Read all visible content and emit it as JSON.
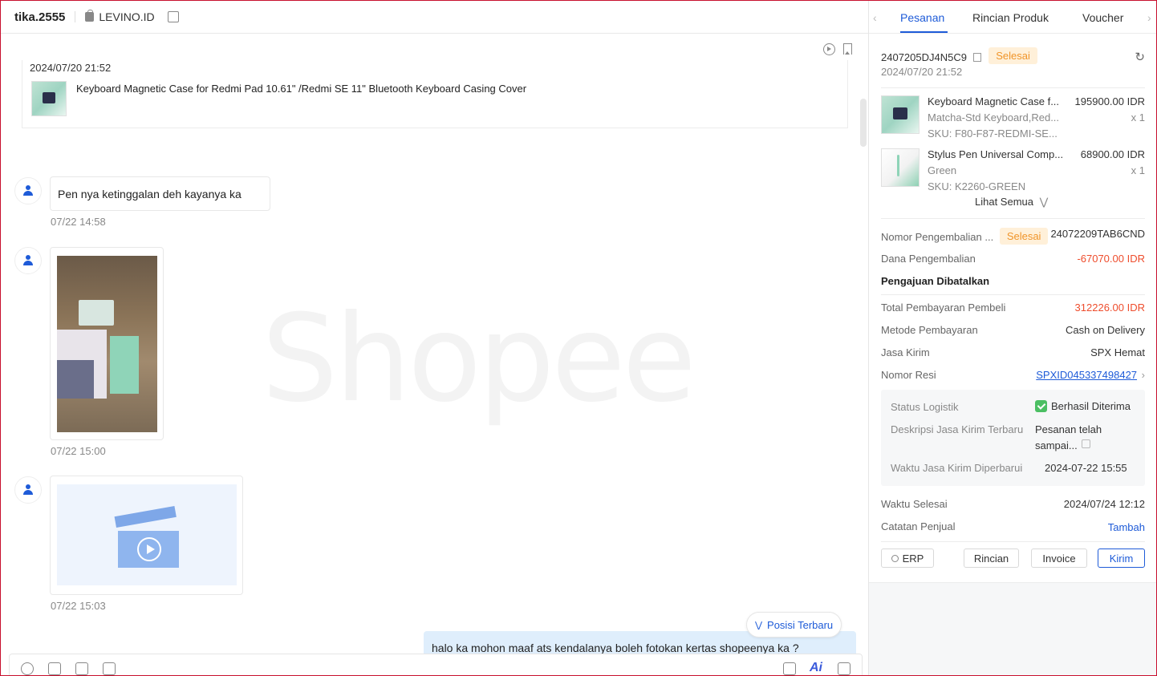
{
  "chat": {
    "username": "tika.2555",
    "shop_name": "LEVINO.ID",
    "order_card": {
      "date": "2024/07/20 21:52",
      "product_title": "Keyboard Magnetic Case for Redmi Pad 10.61\" /Redmi SE 11\" Bluetooth Keyboard Casing Cover"
    },
    "watermark": "Shopee",
    "messages": [
      {
        "type": "text",
        "text": "Pen nya ketinggalan deh kayanya ka",
        "time": "07/22 14:58"
      },
      {
        "type": "image",
        "time": "07/22 15:00"
      },
      {
        "type": "video",
        "time": "07/22 15:03"
      }
    ],
    "latest_button": "Posisi Terbaru",
    "sent_message": "halo ka mohon maaf ats kendalanya boleh fotokan kertas shopeenya ka ?"
  },
  "panel": {
    "tabs": [
      "Pesanan",
      "Rincian Produk",
      "Voucher"
    ],
    "active_tab": "Pesanan",
    "order_id": "2407205DJ4N5C9",
    "order_status": "Selesai",
    "order_date": "2024/07/20 21:52",
    "products": [
      {
        "name": "Keyboard Magnetic Case f...",
        "variant": "Matcha-Std Keyboard,Red...",
        "sku": "SKU: F80-F87-REDMI-SE...",
        "price": "195900.00 IDR",
        "qty": "x 1"
      },
      {
        "name": "Stylus Pen Universal Comp...",
        "variant": "Green",
        "sku": "SKU: K2260-GREEN",
        "price": "68900.00 IDR",
        "qty": "x 1"
      }
    ],
    "see_all": "Lihat Semua",
    "return_number_label": "Nomor Pengembalian ...",
    "return_status": "Selesai",
    "return_number": "24072209TAB6CND",
    "refund_label": "Dana Pengembalian",
    "refund_value": "-67070.00 IDR",
    "cancelled_title": "Pengajuan Dibatalkan",
    "total_label": "Total Pembayaran Pembeli",
    "total_value": "312226.00 IDR",
    "payment_label": "Metode Pembayaran",
    "payment_value": "Cash on Delivery",
    "courier_label": "Jasa Kirim",
    "courier_value": "SPX Hemat",
    "tracking_label": "Nomor Resi",
    "tracking_value": "SPXID045337498427",
    "logistics": {
      "status_label": "Status Logistik",
      "status_value": "Berhasil Diterima",
      "desc_label": "Deskripsi Jasa Kirim Terbaru",
      "desc_value_line1": "Pesanan telah",
      "desc_value_line2": "sampai...",
      "updated_label": "Waktu Jasa Kirim Diperbarui",
      "updated_value": "2024-07-22 15:55"
    },
    "finished_label": "Waktu Selesai",
    "finished_value": "2024/07/24 12:12",
    "seller_note_label": "Catatan Penjual",
    "seller_note_action": "Tambah",
    "buttons": {
      "erp": "ERP",
      "details": "Rincian",
      "invoice": "Invoice",
      "send": "Kirim"
    }
  },
  "colors": {
    "accent": "#1e5bd8",
    "shopee_orange": "#ee4d2d",
    "success": "#4bbf63",
    "badge_bg": "#fff0d9",
    "sent_bubble": "#dfeefc"
  }
}
